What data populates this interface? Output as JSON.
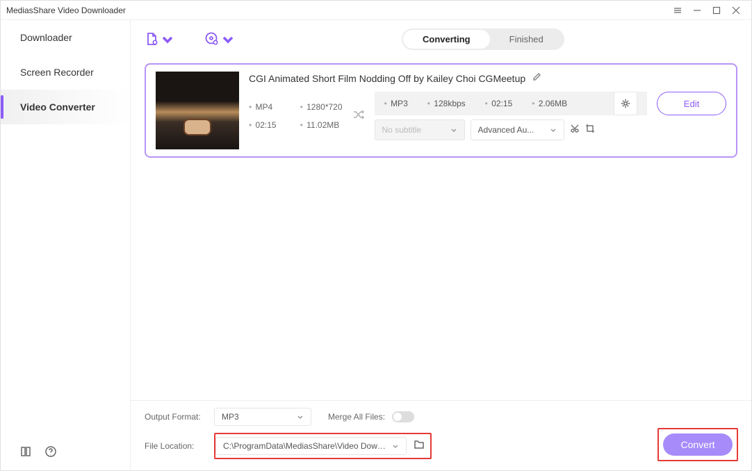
{
  "titlebar": {
    "title": "MediasShare Video Downloader"
  },
  "sidebar": {
    "items": [
      {
        "label": "Downloader"
      },
      {
        "label": "Screen Recorder"
      },
      {
        "label": "Video Converter"
      }
    ]
  },
  "tabs": {
    "converting": "Converting",
    "finished": "Finished"
  },
  "card": {
    "title": "CGI Animated Short Film Nodding Off by Kailey Choi  CGMeetup",
    "source": {
      "format": "MP4",
      "resolution": "1280*720",
      "duration": "02:15",
      "size": "11.02MB"
    },
    "target": {
      "format": "MP3",
      "bitrate": "128kbps",
      "duration": "02:15",
      "size": "2.06MB"
    },
    "subtitle_placeholder": "No subtitle",
    "advanced_label": "Advanced Au...",
    "edit_label": "Edit"
  },
  "bottom": {
    "output_format_label": "Output Format:",
    "output_format_value": "MP3",
    "merge_label": "Merge All Files:",
    "file_location_label": "File Location:",
    "file_location_value": "C:\\ProgramData\\MediasShare\\Video Downloa",
    "convert_label": "Convert"
  }
}
